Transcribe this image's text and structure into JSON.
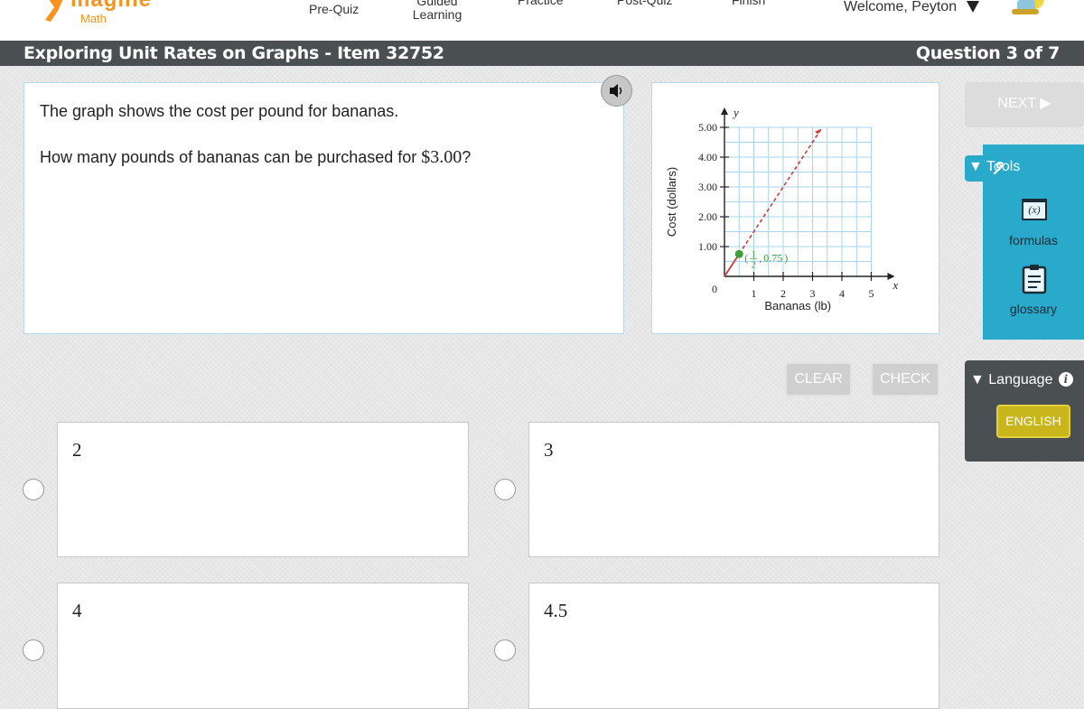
{
  "nav": {
    "logo_word": "magine",
    "logo_sub": "Math",
    "items": [
      "Pre-Quiz",
      "Guided Learning",
      "Practice",
      "Post-Quiz",
      "Finish"
    ],
    "welcome": "Welcome, Peyton"
  },
  "title_bar": {
    "item_title": "Exploring Unit Rates on Graphs - Item 32752",
    "counter": "Question 3 of 7"
  },
  "question": {
    "line1": "The graph shows the cost per pound for bananas.",
    "line2_prefix": "How many pounds of bananas can be purchased for ",
    "line2_amount": "$3.00",
    "line2_suffix": "?"
  },
  "buttons": {
    "next": "NEXT ▶",
    "clear": "CLEAR",
    "check": "CHECK"
  },
  "tools": {
    "label": "▼ Tools",
    "formulas_icon_text": "(x)",
    "formulas": "formulas",
    "glossary": "glossary"
  },
  "language": {
    "label": "▼ Language",
    "info": "i",
    "english": "ENGLISH"
  },
  "answers": [
    "2",
    "3",
    "4",
    "4.5"
  ],
  "chart_data": {
    "type": "line",
    "xlabel": "Bananas (lb)",
    "ylabel": "Cost (dollars)",
    "x_axis_letter": "x",
    "y_axis_letter": "y",
    "origin_label": "0",
    "x_ticks": [
      "1",
      "2",
      "3",
      "4",
      "5"
    ],
    "y_ticks": [
      "1.00",
      "2.00",
      "3.00",
      "4.00",
      "5.00"
    ],
    "xlim": [
      0,
      5
    ],
    "ylim": [
      0,
      5
    ],
    "grid": true,
    "line": {
      "slope": 1.5,
      "style": "dashed",
      "color": "#d33b3b",
      "x_end": 3.3
    },
    "point": {
      "x": 0.5,
      "y": 0.75,
      "label_frac_num": "1",
      "label_frac_den": "2",
      "label_y": "0.75",
      "color": "#3aa03a"
    }
  },
  "colors": {
    "accent": "#f7931e",
    "tools_bg": "#29aacb",
    "title_bg": "#4a5052",
    "english_btn": "#c8b61c"
  }
}
